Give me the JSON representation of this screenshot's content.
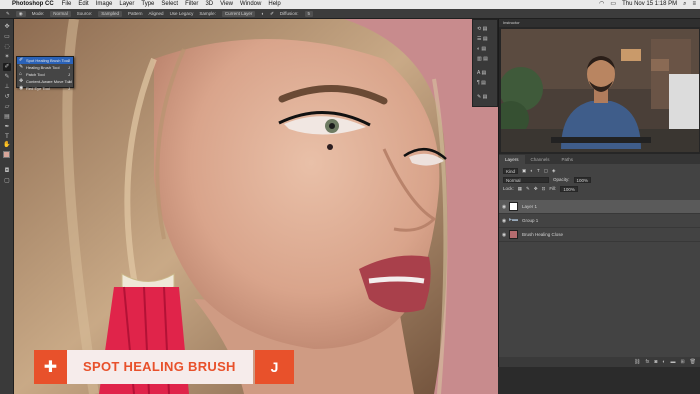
{
  "menubar": {
    "app_name": "Photoshop CC",
    "items": [
      "File",
      "Edit",
      "Image",
      "Layer",
      "Type",
      "Select",
      "Filter",
      "3D",
      "View",
      "Window",
      "Help"
    ],
    "clock": "Thu Nov 15  1:18 PM"
  },
  "options_bar": {
    "mode_label": "Mode:",
    "mode_value": "Normal",
    "source_label": "Source:",
    "sampled": "Sampled",
    "pattern": "Pattern",
    "aligned": "Aligned",
    "legacy": "Use Legacy",
    "sample_label": "Sample:",
    "sample_value": "Current Layer",
    "diffusion_label": "Diffusion:",
    "diffusion_value": "5"
  },
  "flyout": {
    "items": [
      {
        "label": "Spot Healing Brush Tool",
        "key": "J"
      },
      {
        "label": "Healing Brush Tool",
        "key": "J"
      },
      {
        "label": "Patch Tool",
        "key": "J"
      },
      {
        "label": "Content-Aware Move Tool",
        "key": "J"
      },
      {
        "label": "Red Eye Tool",
        "key": "J"
      }
    ]
  },
  "video_panel": {
    "title": "Instructor"
  },
  "layers_panel": {
    "tabs": [
      "Layers",
      "Channels",
      "Paths"
    ],
    "kind_label": "Kind",
    "blend_mode": "Normal",
    "opacity_label": "Opacity:",
    "opacity_value": "100%",
    "lock_label": "Lock:",
    "fill_label": "Fill:",
    "fill_value": "100%",
    "layers": [
      {
        "name": "Layer 1",
        "type": "blank"
      },
      {
        "name": "Group 1",
        "type": "group"
      },
      {
        "name": "Brush Healing Close",
        "type": "image"
      }
    ]
  },
  "caption": {
    "title": "SPOT HEALING BRUSH",
    "shortcut": "J"
  },
  "colors": {
    "accent": "#e8512b",
    "canvas_bg": "#c98e8f",
    "foreground_swatch": "#d8a69a",
    "background_swatch": "#f2f2f2"
  }
}
